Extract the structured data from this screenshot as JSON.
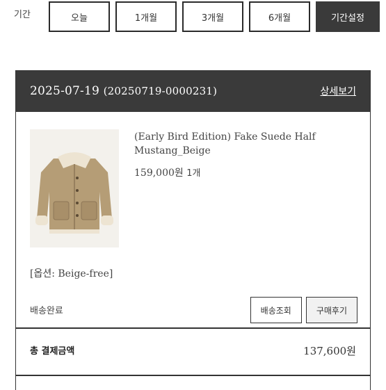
{
  "filter": {
    "label": "기간",
    "buttons": [
      "오늘",
      "1개월",
      "3개월",
      "6개월",
      "기간설정"
    ]
  },
  "order": {
    "date": "2025-07-19",
    "number": "(20250719-0000231)",
    "detail_link": "상세보기",
    "product": {
      "name": "(Early Bird Edition) Fake Suede Half Mustang_Beige",
      "price": "159,000원",
      "quantity": "1개",
      "option": "[옵션: Beige-free]"
    },
    "status": "배송완료",
    "actions": [
      "배송조회",
      "구매후기"
    ],
    "total_label": "총 결제금액",
    "total_value": "137,600원"
  },
  "colors": {
    "header_bg": "#3a3a3a",
    "border": "#333333"
  }
}
